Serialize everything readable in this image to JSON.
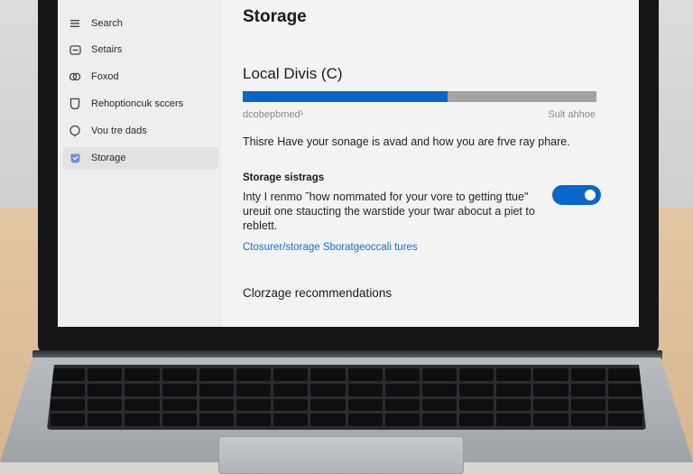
{
  "sidebar": {
    "items": [
      {
        "label": "Search",
        "icon": "search-icon"
      },
      {
        "label": "Setairs",
        "icon": "settings-icon"
      },
      {
        "label": "Foxod",
        "icon": "link-icon"
      },
      {
        "label": "Rehoptioncuk sccers",
        "icon": "shield-icon"
      },
      {
        "label": "Vou tre dads",
        "icon": "chat-icon"
      },
      {
        "label": "Storage",
        "icon": "storage-icon"
      }
    ],
    "active_index": 5
  },
  "main": {
    "page_title": "Storage",
    "drive": {
      "title": "Local Divis (C)",
      "used_fraction": 0.58,
      "used_label": "dcobepbmed¹",
      "size_label": "Sult ahhoe"
    },
    "intro_text": "Thisre Have your sonage is avad and how you are frve ray phare.",
    "storage_sense": {
      "title": "Storage sistrags",
      "description": "Inty I renmo ˜how nommated for your vore to getting ttue\" ureuit one staucting the warstide your twar abocut a piet to reblett.",
      "toggle_on": true
    },
    "config_link": "Ctosurer/storage Sboratgeoccali tures",
    "recommendations_title": "Clorzage recommendations"
  },
  "colors": {
    "accent": "#0a67c9",
    "link": "#1a6dc7",
    "bar_track": "#a3a3a3"
  }
}
